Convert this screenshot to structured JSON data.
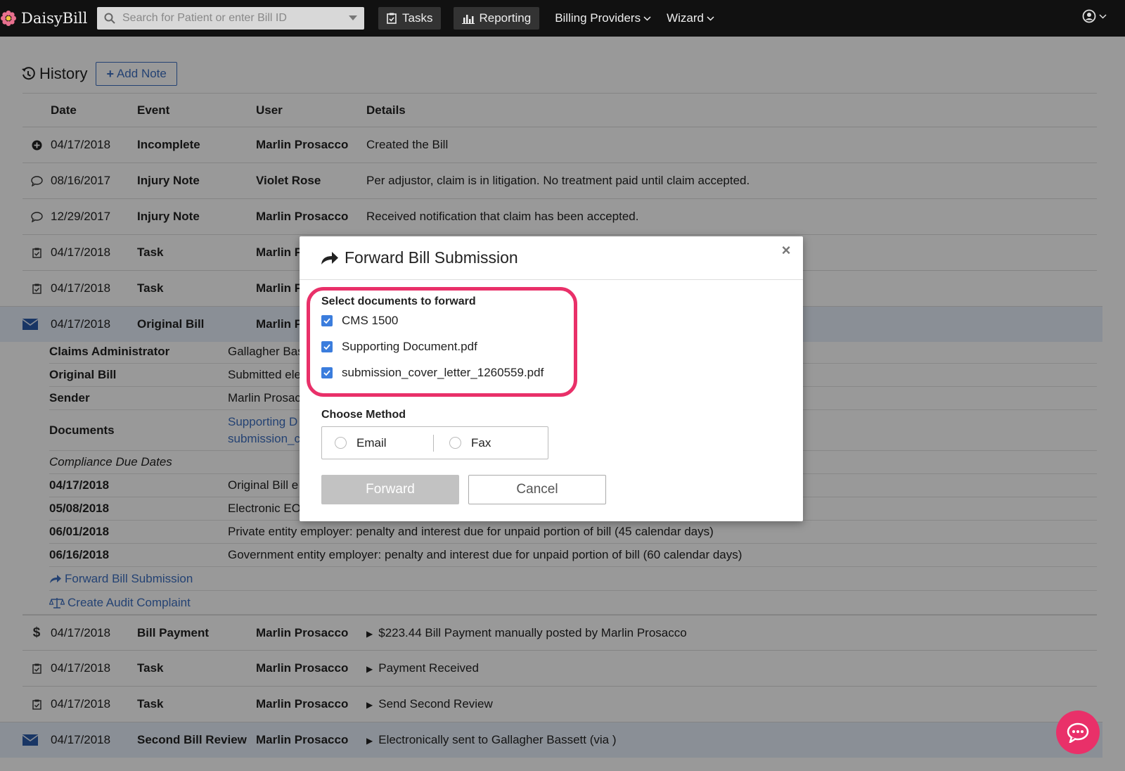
{
  "nav": {
    "brand": "DaisyBill",
    "search_placeholder": "Search for Patient or enter Bill ID",
    "tasks": "Tasks",
    "reporting": "Reporting",
    "billing_providers": "Billing Providers",
    "wizard": "Wizard"
  },
  "history": {
    "title": "History",
    "add_note": "Add Note",
    "columns": [
      "Date",
      "Event",
      "User",
      "Details"
    ],
    "rows": [
      {
        "icon": "plus-circle-icon",
        "date": "04/17/2018",
        "event": "Incomplete",
        "user": "Marlin Prosacco",
        "details": "Created the Bill"
      },
      {
        "icon": "comment-icon",
        "date": "08/16/2017",
        "event": "Injury Note",
        "user": "Violet Rose",
        "details": "Per adjustor, claim is in litigation. No treatment paid until claim accepted."
      },
      {
        "icon": "comment-icon",
        "date": "12/29/2017",
        "event": "Injury Note",
        "user": "Marlin Prosacco",
        "details": "Received notification that claim has been accepted."
      },
      {
        "icon": "clipboard-check-icon",
        "date": "04/17/2018",
        "event": "Task",
        "user": "Marlin P",
        "details": ""
      },
      {
        "icon": "clipboard-check-icon",
        "date": "04/17/2018",
        "event": "Task",
        "user": "Marlin P",
        "details": ""
      },
      {
        "icon": "envelope-icon",
        "date": "04/17/2018",
        "event": "Original Bill",
        "user": "Marlin P",
        "details": ""
      }
    ],
    "bill_detail": {
      "claims_admin_label": "Claims Administrator",
      "claims_admin_value": "Gallagher Bas",
      "original_bill_label": "Original Bill",
      "original_bill_value": "Submitted ele",
      "sender_label": "Sender",
      "sender_value": "Marlin Prosac",
      "documents_label": "Documents",
      "documents": [
        "Supporting D",
        "submission_c"
      ],
      "compliance_label": "Compliance Due Dates",
      "due_dates": [
        {
          "date": "04/17/2018",
          "text": "Original Bill e"
        },
        {
          "date": "05/08/2018",
          "text": "Electronic EO"
        },
        {
          "date": "06/01/2018",
          "text": "Private entity employer: penalty and interest due for unpaid portion of bill (45 calendar days)"
        },
        {
          "date": "06/16/2018",
          "text": "Government entity employer: penalty and interest due for unpaid portion of bill (60 calendar days)"
        }
      ],
      "forward_link": "Forward Bill Submission",
      "audit_link": "Create Audit Complaint"
    },
    "rows_after": [
      {
        "icon": "dollar-icon",
        "date": "04/17/2018",
        "event": "Bill Payment",
        "user": "Marlin Prosacco",
        "details": "$223.44 Bill Payment manually posted by Marlin Prosacco"
      },
      {
        "icon": "clipboard-check-icon",
        "date": "04/17/2018",
        "event": "Task",
        "user": "Marlin Prosacco",
        "details": "Payment Received"
      },
      {
        "icon": "clipboard-check-icon",
        "date": "04/17/2018",
        "event": "Task",
        "user": "Marlin Prosacco",
        "details": "Send Second Review"
      },
      {
        "icon": "envelope-icon",
        "date": "04/17/2018",
        "event": "Second Bill Review",
        "user": "Marlin Prosacco",
        "details": "Electronically sent to Gallagher Bassett (via )"
      }
    ]
  },
  "modal": {
    "title": "Forward Bill Submission",
    "select_label": "Select documents to forward",
    "documents": [
      {
        "name": "CMS 1500",
        "checked": true
      },
      {
        "name": "Supporting Document.pdf",
        "checked": true
      },
      {
        "name": "submission_cover_letter_1260559.pdf",
        "checked": true
      }
    ],
    "method_label": "Choose Method",
    "methods": [
      "Email",
      "Fax"
    ],
    "forward_button": "Forward",
    "cancel_button": "Cancel"
  },
  "colors": {
    "accent": "#3d6fc0",
    "highlight_ring": "#e93069",
    "navbar": "#111111"
  }
}
